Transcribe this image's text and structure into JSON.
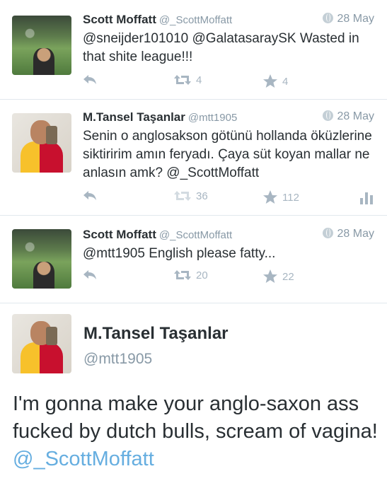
{
  "tweets": [
    {
      "name": "Scott Moffatt",
      "handle": "@_ScottMoffatt",
      "date": "28 May",
      "text": "@sneijder101010 @GalatasaraySK Wasted in that shite league!!!",
      "retweets": "4",
      "favorites": "4"
    },
    {
      "name": "M.Tansel Taşanlar",
      "handle": "@mtt1905",
      "date": "28 May",
      "text": "Senin o anglosakson götünü hollanda öküzlerine siktiririm amın feryadı. Çaya süt koyan mallar ne anlasın amk? @_ScottMoffatt",
      "retweets": "36",
      "favorites": "112"
    },
    {
      "name": "Scott Moffatt",
      "handle": "@_ScottMoffatt",
      "date": "28 May",
      "text": "@mtt1905 English please fatty...",
      "retweets": "20",
      "favorites": "22"
    }
  ],
  "detail": {
    "name": "M.Tansel Taşanlar",
    "handle": "@mtt1905",
    "text": "I'm gonna make your anglo-saxon ass fucked by dutch bulls, scream of vagina!",
    "mention": "@_ScottMoffatt"
  },
  "colors": {
    "link": "#66aee0",
    "muted": "#8899a6",
    "icon": "#a8b6c2"
  },
  "icons": [
    "reply-icon",
    "retweet-icon",
    "star-icon",
    "globe-icon",
    "bars-icon"
  ]
}
